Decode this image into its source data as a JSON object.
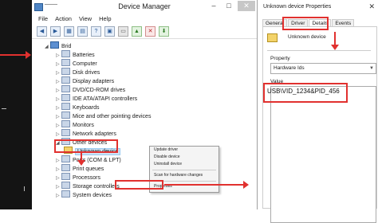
{
  "device_manager": {
    "title": "Device Manager",
    "menu": [
      "File",
      "Action",
      "View",
      "Help"
    ],
    "tree": {
      "root": "Brid",
      "children": [
        "Batteries",
        "Computer",
        "Disk drives",
        "Display adapters",
        "DVD/CD-ROM drives",
        "IDE ATA/ATAPI controllers",
        "Keyboards",
        "Mice and other pointing devices",
        "Monitors",
        "Network adapters",
        "Other devices"
      ],
      "selected_device": "Unknown device",
      "after": [
        "Ports (COM & LPT)",
        "Print queues",
        "Processors",
        "Storage controllers",
        "System devices"
      ]
    },
    "context_menu": [
      "Update driver",
      "Disable device",
      "Uninstall device",
      "Scan for hardware changes",
      "Properties"
    ]
  },
  "properties_dialog": {
    "title": "Unknown device Properties",
    "tabs": [
      "General",
      "Driver",
      "Details",
      "Events"
    ],
    "selected_tab": "Details",
    "device_name": "Unknown device",
    "property_label": "Property",
    "property_value": "Hardware Ids",
    "value_label": "Value",
    "value": "USB\\VID_1234&PID_456"
  },
  "accent_colors": {
    "highlight": "#e1312f",
    "selection": "#cce4f7"
  }
}
